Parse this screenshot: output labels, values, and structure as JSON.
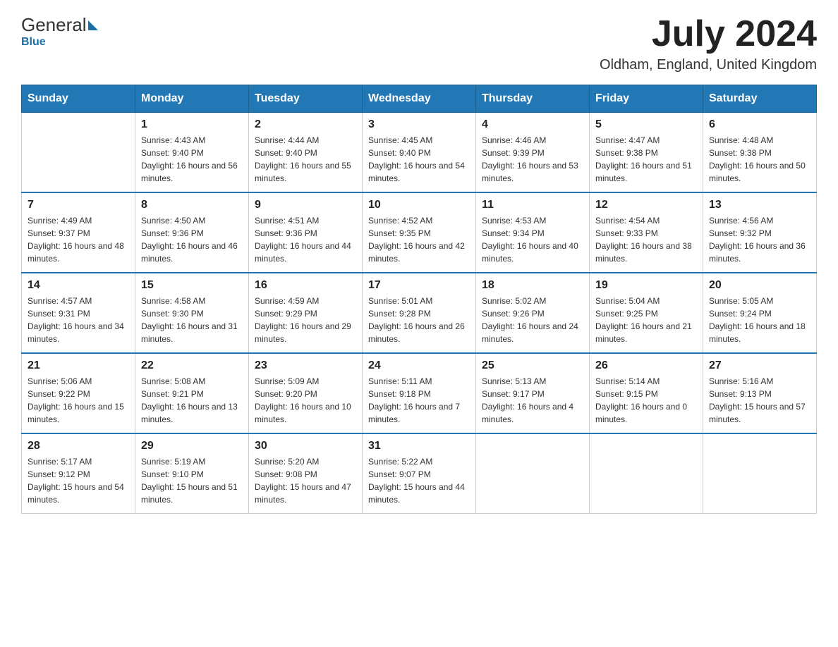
{
  "header": {
    "logo_general": "General",
    "logo_blue": "Blue",
    "month_title": "July 2024",
    "location": "Oldham, England, United Kingdom"
  },
  "days_of_week": [
    "Sunday",
    "Monday",
    "Tuesday",
    "Wednesday",
    "Thursday",
    "Friday",
    "Saturday"
  ],
  "weeks": [
    [
      {
        "day": "",
        "sunrise": "",
        "sunset": "",
        "daylight": ""
      },
      {
        "day": "1",
        "sunrise": "Sunrise: 4:43 AM",
        "sunset": "Sunset: 9:40 PM",
        "daylight": "Daylight: 16 hours and 56 minutes."
      },
      {
        "day": "2",
        "sunrise": "Sunrise: 4:44 AM",
        "sunset": "Sunset: 9:40 PM",
        "daylight": "Daylight: 16 hours and 55 minutes."
      },
      {
        "day": "3",
        "sunrise": "Sunrise: 4:45 AM",
        "sunset": "Sunset: 9:40 PM",
        "daylight": "Daylight: 16 hours and 54 minutes."
      },
      {
        "day": "4",
        "sunrise": "Sunrise: 4:46 AM",
        "sunset": "Sunset: 9:39 PM",
        "daylight": "Daylight: 16 hours and 53 minutes."
      },
      {
        "day": "5",
        "sunrise": "Sunrise: 4:47 AM",
        "sunset": "Sunset: 9:38 PM",
        "daylight": "Daylight: 16 hours and 51 minutes."
      },
      {
        "day": "6",
        "sunrise": "Sunrise: 4:48 AM",
        "sunset": "Sunset: 9:38 PM",
        "daylight": "Daylight: 16 hours and 50 minutes."
      }
    ],
    [
      {
        "day": "7",
        "sunrise": "Sunrise: 4:49 AM",
        "sunset": "Sunset: 9:37 PM",
        "daylight": "Daylight: 16 hours and 48 minutes."
      },
      {
        "day": "8",
        "sunrise": "Sunrise: 4:50 AM",
        "sunset": "Sunset: 9:36 PM",
        "daylight": "Daylight: 16 hours and 46 minutes."
      },
      {
        "day": "9",
        "sunrise": "Sunrise: 4:51 AM",
        "sunset": "Sunset: 9:36 PM",
        "daylight": "Daylight: 16 hours and 44 minutes."
      },
      {
        "day": "10",
        "sunrise": "Sunrise: 4:52 AM",
        "sunset": "Sunset: 9:35 PM",
        "daylight": "Daylight: 16 hours and 42 minutes."
      },
      {
        "day": "11",
        "sunrise": "Sunrise: 4:53 AM",
        "sunset": "Sunset: 9:34 PM",
        "daylight": "Daylight: 16 hours and 40 minutes."
      },
      {
        "day": "12",
        "sunrise": "Sunrise: 4:54 AM",
        "sunset": "Sunset: 9:33 PM",
        "daylight": "Daylight: 16 hours and 38 minutes."
      },
      {
        "day": "13",
        "sunrise": "Sunrise: 4:56 AM",
        "sunset": "Sunset: 9:32 PM",
        "daylight": "Daylight: 16 hours and 36 minutes."
      }
    ],
    [
      {
        "day": "14",
        "sunrise": "Sunrise: 4:57 AM",
        "sunset": "Sunset: 9:31 PM",
        "daylight": "Daylight: 16 hours and 34 minutes."
      },
      {
        "day": "15",
        "sunrise": "Sunrise: 4:58 AM",
        "sunset": "Sunset: 9:30 PM",
        "daylight": "Daylight: 16 hours and 31 minutes."
      },
      {
        "day": "16",
        "sunrise": "Sunrise: 4:59 AM",
        "sunset": "Sunset: 9:29 PM",
        "daylight": "Daylight: 16 hours and 29 minutes."
      },
      {
        "day": "17",
        "sunrise": "Sunrise: 5:01 AM",
        "sunset": "Sunset: 9:28 PM",
        "daylight": "Daylight: 16 hours and 26 minutes."
      },
      {
        "day": "18",
        "sunrise": "Sunrise: 5:02 AM",
        "sunset": "Sunset: 9:26 PM",
        "daylight": "Daylight: 16 hours and 24 minutes."
      },
      {
        "day": "19",
        "sunrise": "Sunrise: 5:04 AM",
        "sunset": "Sunset: 9:25 PM",
        "daylight": "Daylight: 16 hours and 21 minutes."
      },
      {
        "day": "20",
        "sunrise": "Sunrise: 5:05 AM",
        "sunset": "Sunset: 9:24 PM",
        "daylight": "Daylight: 16 hours and 18 minutes."
      }
    ],
    [
      {
        "day": "21",
        "sunrise": "Sunrise: 5:06 AM",
        "sunset": "Sunset: 9:22 PM",
        "daylight": "Daylight: 16 hours and 15 minutes."
      },
      {
        "day": "22",
        "sunrise": "Sunrise: 5:08 AM",
        "sunset": "Sunset: 9:21 PM",
        "daylight": "Daylight: 16 hours and 13 minutes."
      },
      {
        "day": "23",
        "sunrise": "Sunrise: 5:09 AM",
        "sunset": "Sunset: 9:20 PM",
        "daylight": "Daylight: 16 hours and 10 minutes."
      },
      {
        "day": "24",
        "sunrise": "Sunrise: 5:11 AM",
        "sunset": "Sunset: 9:18 PM",
        "daylight": "Daylight: 16 hours and 7 minutes."
      },
      {
        "day": "25",
        "sunrise": "Sunrise: 5:13 AM",
        "sunset": "Sunset: 9:17 PM",
        "daylight": "Daylight: 16 hours and 4 minutes."
      },
      {
        "day": "26",
        "sunrise": "Sunrise: 5:14 AM",
        "sunset": "Sunset: 9:15 PM",
        "daylight": "Daylight: 16 hours and 0 minutes."
      },
      {
        "day": "27",
        "sunrise": "Sunrise: 5:16 AM",
        "sunset": "Sunset: 9:13 PM",
        "daylight": "Daylight: 15 hours and 57 minutes."
      }
    ],
    [
      {
        "day": "28",
        "sunrise": "Sunrise: 5:17 AM",
        "sunset": "Sunset: 9:12 PM",
        "daylight": "Daylight: 15 hours and 54 minutes."
      },
      {
        "day": "29",
        "sunrise": "Sunrise: 5:19 AM",
        "sunset": "Sunset: 9:10 PM",
        "daylight": "Daylight: 15 hours and 51 minutes."
      },
      {
        "day": "30",
        "sunrise": "Sunrise: 5:20 AM",
        "sunset": "Sunset: 9:08 PM",
        "daylight": "Daylight: 15 hours and 47 minutes."
      },
      {
        "day": "31",
        "sunrise": "Sunrise: 5:22 AM",
        "sunset": "Sunset: 9:07 PM",
        "daylight": "Daylight: 15 hours and 44 minutes."
      },
      {
        "day": "",
        "sunrise": "",
        "sunset": "",
        "daylight": ""
      },
      {
        "day": "",
        "sunrise": "",
        "sunset": "",
        "daylight": ""
      },
      {
        "day": "",
        "sunrise": "",
        "sunset": "",
        "daylight": ""
      }
    ]
  ]
}
